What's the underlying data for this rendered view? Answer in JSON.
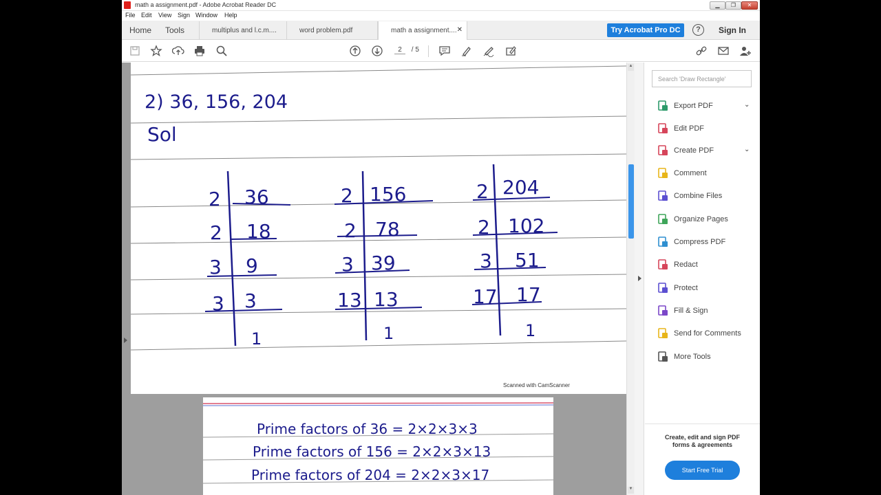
{
  "window": {
    "title": "math a assignment.pdf - Adobe Acrobat Reader DC"
  },
  "menu": [
    "File",
    "Edit",
    "View",
    "Sign",
    "Window",
    "Help"
  ],
  "nav": {
    "home": "Home",
    "tools": "Tools"
  },
  "tabs": [
    {
      "label": "multiplus and l.c.m...."
    },
    {
      "label": "word problem.pdf"
    },
    {
      "label": "math a assignment...."
    }
  ],
  "header": {
    "try_button": "Try Acrobat Pro DC",
    "sign_in": "Sign In",
    "help": "?"
  },
  "pagination": {
    "current": "2",
    "total": "/ 5"
  },
  "document": {
    "question": "2)  36, 156, 204",
    "sol": "Sol",
    "divisions": [
      {
        "rows": [
          [
            "2",
            "36"
          ],
          [
            "2",
            "18"
          ],
          [
            "3",
            "9"
          ],
          [
            "3",
            "3"
          ],
          [
            "",
            "1"
          ]
        ]
      },
      {
        "rows": [
          [
            "2",
            "156"
          ],
          [
            "2",
            "78"
          ],
          [
            "3",
            "39"
          ],
          [
            "13",
            "13"
          ],
          [
            "",
            "1"
          ]
        ]
      },
      {
        "rows": [
          [
            "2",
            "204"
          ],
          [
            "2",
            "102"
          ],
          [
            "3",
            "51"
          ],
          [
            "17",
            "17"
          ],
          [
            "",
            "1"
          ]
        ]
      }
    ],
    "scan_note": "Scanned with CamScanner",
    "prime_lines": [
      "Prime factors of 36 = 2×2×3×3",
      "Prime factors of 156 = 2×2×3×13",
      "Prime factors of 204 = 2×2×3×17"
    ]
  },
  "right_pane": {
    "search_placeholder": "Search 'Draw Rectangle'",
    "tools": [
      {
        "label": "Export PDF",
        "icon": "export-pdf-icon",
        "color": "#2c9a6a",
        "chevron": "⌄"
      },
      {
        "label": "Edit PDF",
        "icon": "edit-pdf-icon",
        "color": "#d6455a",
        "chevron": ""
      },
      {
        "label": "Create PDF",
        "icon": "create-pdf-icon",
        "color": "#d6455a",
        "chevron": "⌄"
      },
      {
        "label": "Comment",
        "icon": "comment-icon",
        "color": "#e8b51a",
        "chevron": ""
      },
      {
        "label": "Combine Files",
        "icon": "combine-files-icon",
        "color": "#5b4fd1",
        "chevron": ""
      },
      {
        "label": "Organize Pages",
        "icon": "organize-pages-icon",
        "color": "#3fa55a",
        "chevron": ""
      },
      {
        "label": "Compress PDF",
        "icon": "compress-pdf-icon",
        "color": "#2f8fd0",
        "chevron": ""
      },
      {
        "label": "Redact",
        "icon": "redact-icon",
        "color": "#d6455a",
        "chevron": ""
      },
      {
        "label": "Protect",
        "icon": "protect-icon",
        "color": "#5b4fd1",
        "chevron": ""
      },
      {
        "label": "Fill & Sign",
        "icon": "fill-sign-icon",
        "color": "#7b47c8",
        "chevron": ""
      },
      {
        "label": "Send for Comments",
        "icon": "send-for-comments-icon",
        "color": "#e8b51a",
        "chevron": ""
      },
      {
        "label": "More Tools",
        "icon": "more-tools-icon",
        "color": "#555555",
        "chevron": ""
      }
    ],
    "promo_text_1": "Create, edit and sign PDF",
    "promo_text_2": "forms & agreements",
    "trial_button": "Start Free Trial"
  }
}
